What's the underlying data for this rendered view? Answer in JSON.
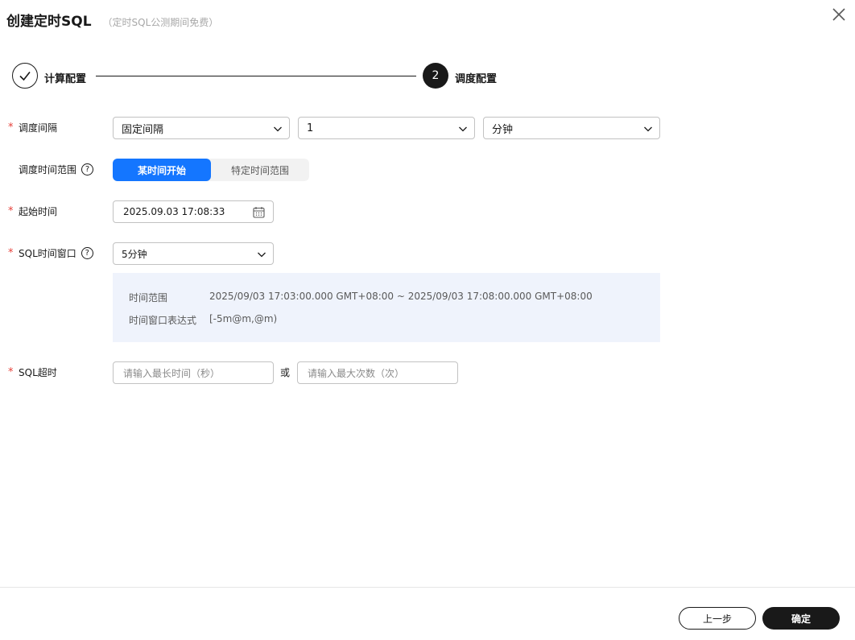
{
  "header": {
    "title": "创建定时SQL",
    "subtitle": "（定时SQL公测期间免费）"
  },
  "steps": [
    {
      "label": "计算配置",
      "state": "done"
    },
    {
      "label": "调度配置",
      "number": "2",
      "state": "active"
    }
  ],
  "form": {
    "interval": {
      "label": "调度间隔",
      "required": "*",
      "type_value": "固定间隔",
      "amount_value": "1",
      "unit_value": "分钟"
    },
    "time_range": {
      "label": "调度时间范围",
      "help": "?",
      "options": [
        "某时间开始",
        "特定时间范围"
      ],
      "selected": "某时间开始"
    },
    "start_time": {
      "label": "起始时间",
      "required": "*",
      "value": "2025.09.03 17:08:33"
    },
    "sql_window": {
      "label": "SQL时间窗口",
      "required": "*",
      "help": "?",
      "value": "5分钟",
      "info": {
        "range_label": "时间范围",
        "range_value": "2025/09/03 17:03:00.000 GMT+08:00 ~ 2025/09/03 17:08:00.000 GMT+08:00",
        "expr_label": "时间窗口表达式",
        "expr_value": "[-5m@m,@m)"
      }
    },
    "sql_timeout": {
      "label": "SQL超时",
      "required": "*",
      "max_time_placeholder": "请输入最长时间（秒）",
      "or_text": "或",
      "max_count_placeholder": "请输入最大次数（次）"
    }
  },
  "footer": {
    "prev_label": "上一步",
    "confirm_label": "确定"
  },
  "colors": {
    "accent": "#1476ff",
    "required": "#e6413a",
    "dark": "#191919",
    "info_bg": "#eff3fc"
  }
}
